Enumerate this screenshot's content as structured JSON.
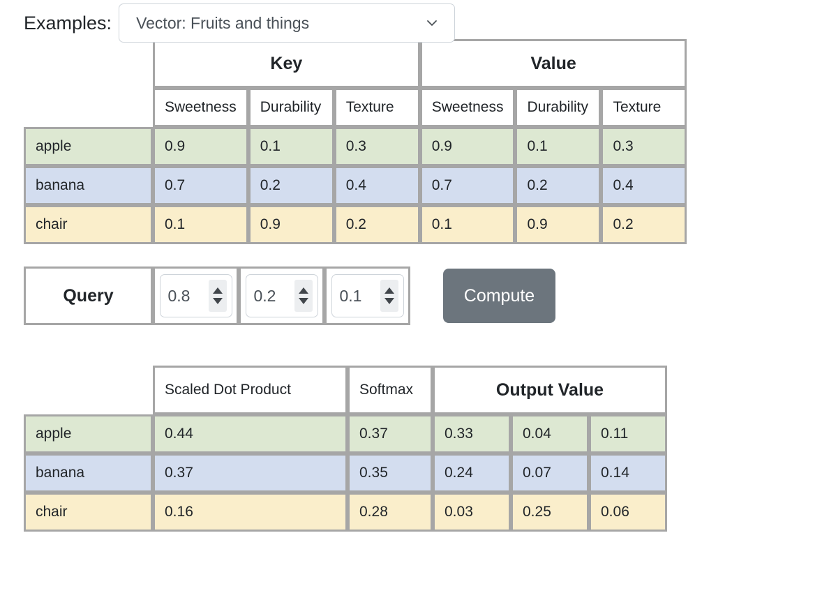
{
  "examples": {
    "label": "Examples:",
    "selected": "Vector: Fruits and things",
    "chevron_icon": "chevron-down-icon"
  },
  "attention_table": {
    "groups": [
      "Key",
      "Value"
    ],
    "sub_headers": [
      "Sweetness",
      "Durability",
      "Texture",
      "Sweetness",
      "Durability",
      "Texture"
    ],
    "rows": [
      {
        "label": "apple",
        "color": "#dde8d2",
        "values": [
          "0.9",
          "0.1",
          "0.3",
          "0.9",
          "0.1",
          "0.3"
        ]
      },
      {
        "label": "banana",
        "color": "#d3ddef",
        "values": [
          "0.7",
          "0.2",
          "0.4",
          "0.7",
          "0.2",
          "0.4"
        ]
      },
      {
        "label": "chair",
        "color": "#faeecb",
        "values": [
          "0.1",
          "0.9",
          "0.2",
          "0.1",
          "0.9",
          "0.2"
        ]
      }
    ]
  },
  "query": {
    "label": "Query",
    "values": [
      "0.8",
      "0.2",
      "0.1"
    ],
    "compute_label": "Compute"
  },
  "output_table": {
    "headers": [
      "Scaled Dot Product",
      "Softmax",
      "Output Value"
    ],
    "rows": [
      {
        "label": "apple",
        "color": "#dde8d2",
        "scaled_dot_product": "0.44",
        "softmax": "0.37",
        "output_value": [
          "0.33",
          "0.04",
          "0.11"
        ]
      },
      {
        "label": "banana",
        "color": "#d3ddef",
        "scaled_dot_product": "0.37",
        "softmax": "0.35",
        "output_value": [
          "0.24",
          "0.07",
          "0.14"
        ]
      },
      {
        "label": "chair",
        "color": "#faeecb",
        "scaled_dot_product": "0.16",
        "softmax": "0.28",
        "output_value": [
          "0.03",
          "0.25",
          "0.06"
        ]
      }
    ]
  },
  "colors": {
    "border": "#a6a6a6",
    "button": "#6c757d",
    "input_border": "#ced4da",
    "row_green": "#dde8d2",
    "row_blue": "#d3ddef",
    "row_yellow": "#faeecb"
  }
}
